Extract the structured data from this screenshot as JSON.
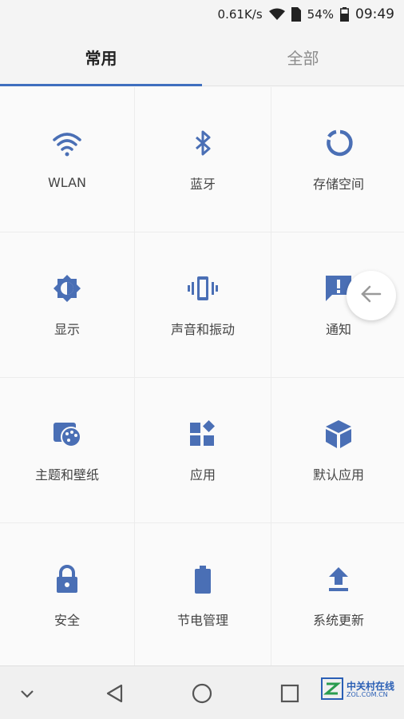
{
  "status_bar": {
    "net_speed": "0.61K/s",
    "battery_percent": "54%",
    "time": "09:49",
    "icons": [
      "wifi-icon",
      "sim-icon",
      "battery-icon"
    ]
  },
  "tabs": [
    {
      "label": "常用",
      "active": true
    },
    {
      "label": "全部",
      "active": false
    }
  ],
  "tiles": [
    {
      "label": "WLAN",
      "icon": "wifi-icon"
    },
    {
      "label": "蓝牙",
      "icon": "bluetooth-icon"
    },
    {
      "label": "存储空间",
      "icon": "storage-icon"
    },
    {
      "label": "显示",
      "icon": "brightness-icon"
    },
    {
      "label": "声音和振动",
      "icon": "vibration-icon"
    },
    {
      "label": "通知",
      "icon": "notification-icon"
    },
    {
      "label": "主题和壁纸",
      "icon": "theme-icon"
    },
    {
      "label": "应用",
      "icon": "apps-icon"
    },
    {
      "label": "默认应用",
      "icon": "default-apps-icon"
    },
    {
      "label": "安全",
      "icon": "lock-icon"
    },
    {
      "label": "节电管理",
      "icon": "battery-saver-icon"
    },
    {
      "label": "系统更新",
      "icon": "system-update-icon"
    }
  ],
  "floating_back": {
    "icon": "arrow-left-icon"
  },
  "nav_bar": {
    "buttons": [
      "chevron-down-icon",
      "back-triangle-icon",
      "home-circle-icon",
      "recents-square-icon"
    ],
    "watermark": {
      "cn": "中关村在线",
      "en": "ZOL.COM.CN"
    }
  },
  "colors": {
    "accent": "#3f6fbf",
    "icon": "#4a6fb5"
  }
}
